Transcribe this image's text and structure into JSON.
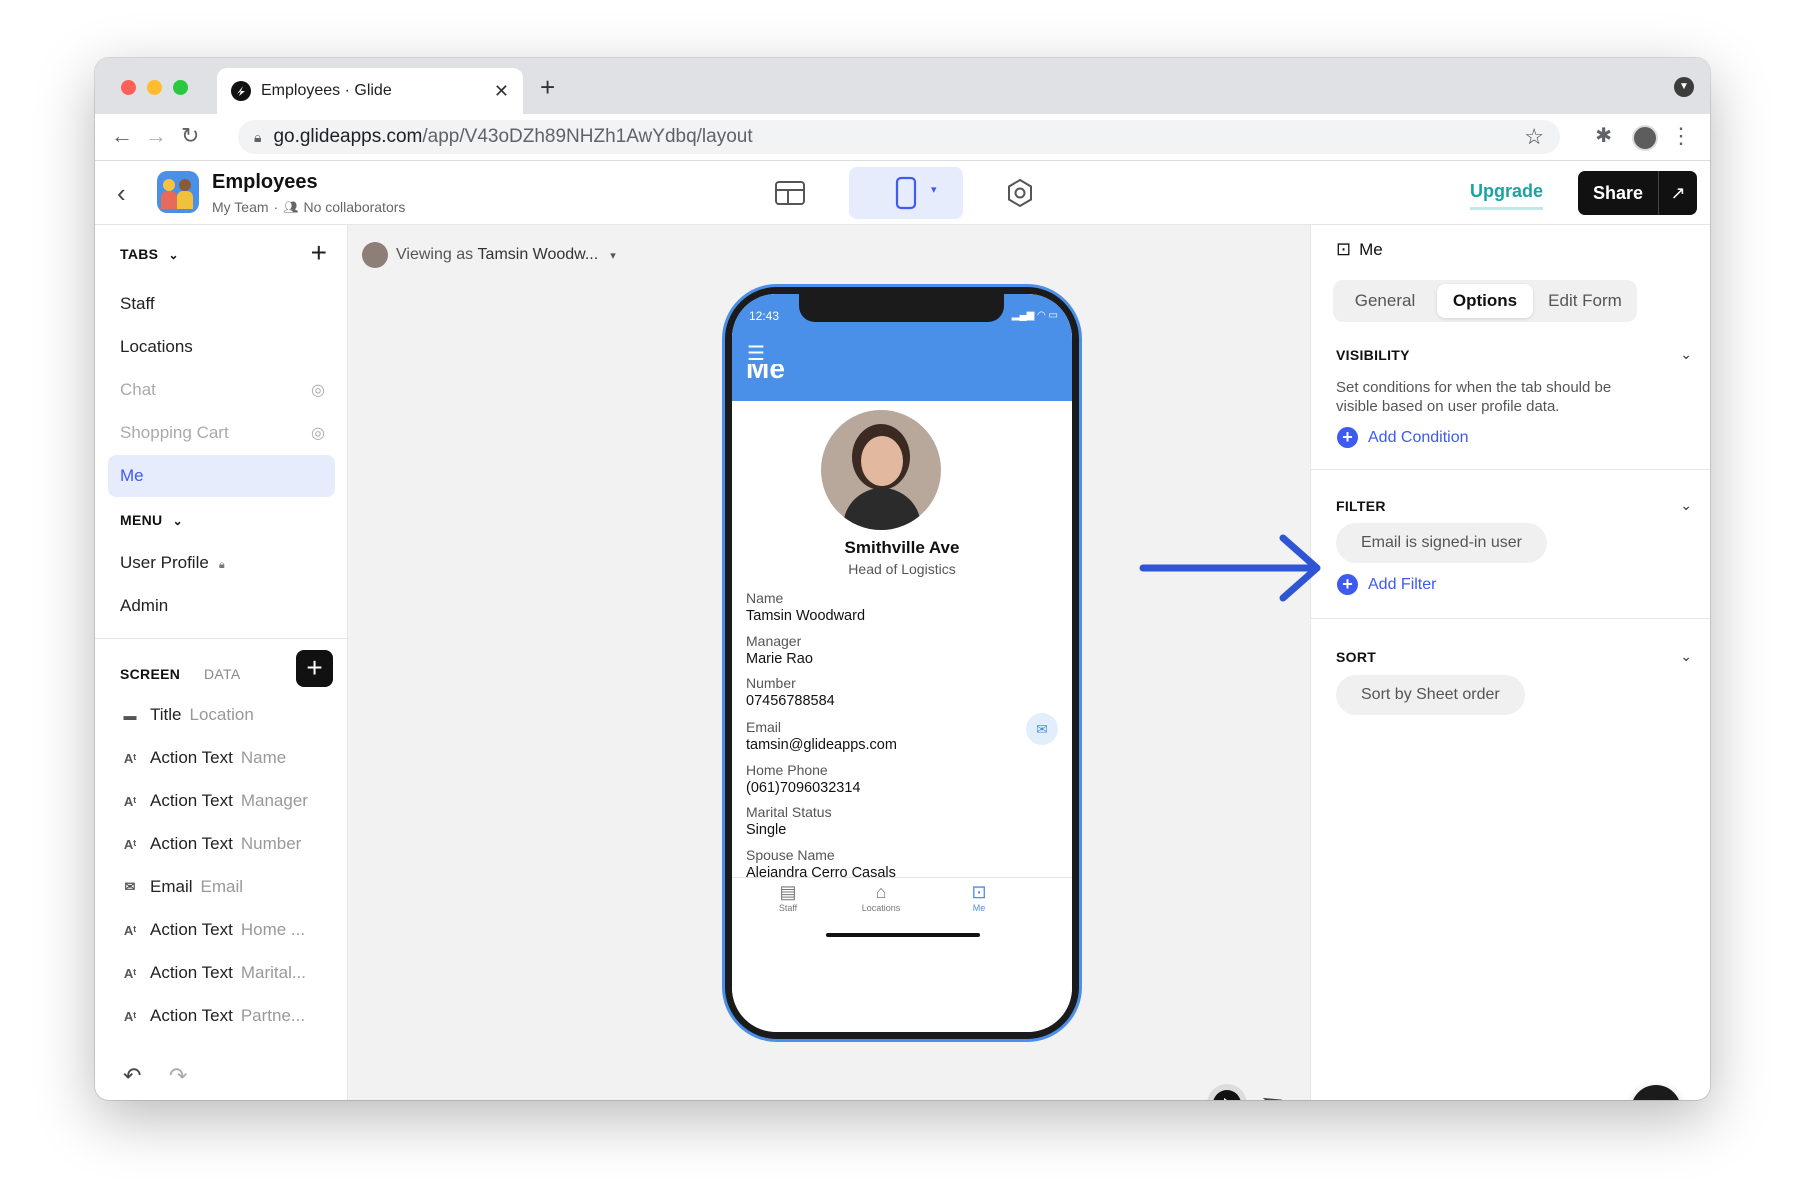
{
  "browser": {
    "tab_title": "Employees · Glide",
    "url_host": "go.glideapps.com",
    "url_path": "/app/V43oDZh89NHZh1AwYdbq/layout"
  },
  "header": {
    "app_name": "Employees",
    "team": "My Team",
    "collaborators": "No collaborators",
    "upgrade_label": "Upgrade",
    "share_label": "Share"
  },
  "tabs_panel": {
    "heading": "TABS",
    "items": [
      {
        "label": "Staff",
        "hidden": false
      },
      {
        "label": "Locations",
        "hidden": false
      },
      {
        "label": "Chat",
        "hidden": true
      },
      {
        "label": "Shopping Cart",
        "hidden": true
      },
      {
        "label": "Me",
        "selected": true
      }
    ],
    "menu_heading": "MENU",
    "menu_items": [
      {
        "label": "User Profile",
        "locked": true
      },
      {
        "label": "Admin"
      }
    ]
  },
  "screen_panel": {
    "tab_screen": "SCREEN",
    "tab_data": "DATA",
    "components": [
      {
        "type": "Title",
        "value": "Location",
        "icon": "title-icon"
      },
      {
        "type": "Action Text",
        "value": "Name",
        "icon": "action-text-icon"
      },
      {
        "type": "Action Text",
        "value": "Manager",
        "icon": "action-text-icon"
      },
      {
        "type": "Action Text",
        "value": "Number",
        "icon": "action-text-icon"
      },
      {
        "type": "Email",
        "value": "Email",
        "icon": "email-icon"
      },
      {
        "type": "Action Text",
        "value": "Home ...",
        "icon": "action-text-icon"
      },
      {
        "type": "Action Text",
        "value": "Marital...",
        "icon": "action-text-icon"
      },
      {
        "type": "Action Text",
        "value": "Partne...",
        "icon": "action-text-icon"
      }
    ]
  },
  "canvas": {
    "viewing_as_prefix": "Viewing as",
    "viewing_as_name": "Tamsin Woodw..."
  },
  "phone": {
    "time": "12:43",
    "screen_title": "Me",
    "profile_title": "Smithville Ave",
    "profile_subtitle": "Head of Logistics",
    "fields": [
      {
        "label": "Name",
        "value": "Tamsin Woodward"
      },
      {
        "label": "Manager",
        "value": "Marie Rao"
      },
      {
        "label": "Number",
        "value": "07456788584"
      },
      {
        "label": "Email",
        "value": "tamsin@glideapps.com"
      },
      {
        "label": "Home Phone",
        "value": "(061)7096032314"
      },
      {
        "label": "Marital Status",
        "value": "Single"
      },
      {
        "label": "Spouse Name",
        "value": "Alejandra Cerro Casals"
      }
    ],
    "nav": [
      {
        "label": "Staff"
      },
      {
        "label": "Locations"
      },
      {
        "label": "Me",
        "active": true
      }
    ]
  },
  "properties": {
    "title": "Me",
    "segments": [
      "General",
      "Options",
      "Edit Form"
    ],
    "active_segment": "Options",
    "visibility": {
      "heading": "VISIBILITY",
      "description": "Set conditions for when the tab should be visible based on user profile data.",
      "add_label": "Add Condition"
    },
    "filter": {
      "heading": "FILTER",
      "chip": "Email is signed-in user",
      "add_label": "Add Filter"
    },
    "sort": {
      "heading": "SORT",
      "chip": "Sort by Sheet order"
    },
    "help_label": "?"
  },
  "colors": {
    "accent": "#3d5af1",
    "phone_header": "#4a8fe8",
    "arrow": "#2f55d4",
    "upgrade": "#1aa3a3"
  }
}
